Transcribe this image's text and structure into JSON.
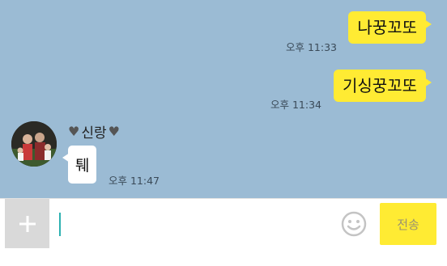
{
  "messages": [
    {
      "direction": "out",
      "text": "나꿍꼬또",
      "time": "오후 11:33"
    },
    {
      "direction": "out",
      "text": "기싱꿍꼬또",
      "time": "오후 11:34"
    },
    {
      "direction": "in",
      "sender": "신랑",
      "text": "퉤",
      "time": "오후 11:47"
    }
  ],
  "sender_decoration": {
    "left": "♥",
    "right": "♥"
  },
  "input": {
    "value": "",
    "placeholder": ""
  },
  "buttons": {
    "send": "전송",
    "attach_icon": "plus-icon",
    "emoji_icon": "emoji-icon"
  },
  "colors": {
    "chat_background": "#9bbbd4",
    "outgoing_bubble": "#ffeb33",
    "incoming_bubble": "#ffffff",
    "send_button": "#ffeb33",
    "attach_button": "#d9d9d9",
    "caret": "#2db1b1"
  }
}
